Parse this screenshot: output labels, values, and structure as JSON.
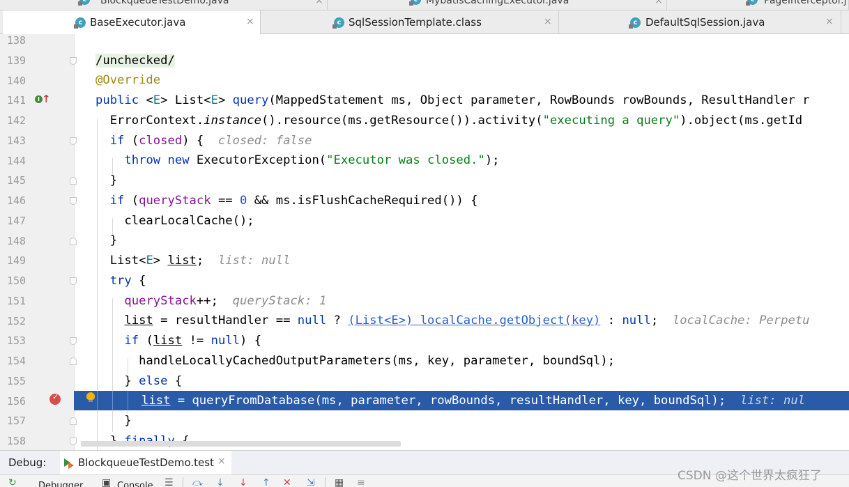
{
  "tabs_top": [
    {
      "label": "BlockqueueTestDemo.java"
    },
    {
      "label": "MybatisCachingExecutor.java"
    },
    {
      "label": "PageInterceptor.j"
    }
  ],
  "tabs": [
    {
      "label": "BaseExecutor.java",
      "active": true
    },
    {
      "label": "SqlSessionTemplate.class",
      "active": false
    },
    {
      "label": "DefaultSqlSession.java",
      "active": false
    }
  ],
  "file_icon_letter": "c",
  "close_glyph": "×",
  "line_numbers": [
    "138",
    "139",
    "140",
    "141",
    "142",
    "143",
    "144",
    "145",
    "146",
    "147",
    "148",
    "149",
    "150",
    "151",
    "152",
    "153",
    "154",
    "155",
    "156",
    "157",
    "158"
  ],
  "code": [
    {
      "id": "c139",
      "parts": [
        {
          "t": "/unchecked/",
          "c": "ucbg"
        }
      ]
    },
    {
      "id": "c140",
      "parts": [
        {
          "t": "@Override",
          "c": "ann"
        }
      ]
    },
    {
      "id": "c141",
      "parts": [
        {
          "t": "public ",
          "c": "kw"
        },
        {
          "t": "<"
        },
        {
          "t": "E",
          "c": "tp"
        },
        {
          "t": "> List<"
        },
        {
          "t": "E",
          "c": "tp"
        },
        {
          "t": "> "
        },
        {
          "t": "query",
          "c": "kw"
        },
        {
          "t": "(MappedStatement ms, Object parameter, RowBounds rowBounds, ResultHandler r"
        }
      ]
    },
    {
      "id": "c142",
      "parts": [
        {
          "t": "  ErrorContext."
        },
        {
          "t": "instance",
          "c": "ital"
        },
        {
          "t": "().resource(ms.getResource()).activity("
        },
        {
          "t": "\"executing a query\"",
          "c": "str"
        },
        {
          "t": ").object(ms.getId"
        }
      ]
    },
    {
      "id": "c143",
      "parts": [
        {
          "t": "  "
        },
        {
          "t": "if",
          "c": "kw"
        },
        {
          "t": " ("
        },
        {
          "t": "closed",
          "c": "fld"
        },
        {
          "t": ") {  "
        },
        {
          "t": "closed: false",
          "c": "hint"
        }
      ]
    },
    {
      "id": "c144",
      "parts": [
        {
          "t": "    "
        },
        {
          "t": "throw new",
          "c": "kw"
        },
        {
          "t": " ExecutorException("
        },
        {
          "t": "\"Executor was closed.\"",
          "c": "str"
        },
        {
          "t": ");"
        }
      ]
    },
    {
      "id": "c145",
      "parts": [
        {
          "t": "  }"
        }
      ]
    },
    {
      "id": "c146",
      "parts": [
        {
          "t": "  "
        },
        {
          "t": "if",
          "c": "kw"
        },
        {
          "t": " ("
        },
        {
          "t": "queryStack",
          "c": "fld"
        },
        {
          "t": " == "
        },
        {
          "t": "0",
          "c": "num"
        },
        {
          "t": " && ms.isFlushCacheRequired()) {"
        }
      ]
    },
    {
      "id": "c147",
      "parts": [
        {
          "t": "    clearLocalCache();"
        }
      ]
    },
    {
      "id": "c148",
      "parts": [
        {
          "t": "  }"
        }
      ]
    },
    {
      "id": "c149",
      "parts": [
        {
          "t": "  List<"
        },
        {
          "t": "E",
          "c": "tp"
        },
        {
          "t": "> "
        },
        {
          "t": "list",
          "c": "ul"
        },
        {
          "t": ";  "
        },
        {
          "t": "list: null",
          "c": "hint"
        }
      ]
    },
    {
      "id": "c150",
      "parts": [
        {
          "t": "  "
        },
        {
          "t": "try",
          "c": "kw"
        },
        {
          "t": " {"
        }
      ]
    },
    {
      "id": "c151",
      "parts": [
        {
          "t": "    "
        },
        {
          "t": "queryStack",
          "c": "fld"
        },
        {
          "t": "++;  "
        },
        {
          "t": "queryStack: 1",
          "c": "hint"
        }
      ]
    },
    {
      "id": "c152",
      "parts": [
        {
          "t": "    "
        },
        {
          "t": "list",
          "c": "ul"
        },
        {
          "t": " = resultHandler == "
        },
        {
          "t": "null",
          "c": "kw"
        },
        {
          "t": " ? "
        },
        {
          "t": "(List<E>) localCache.getObject(key)",
          "c": "lnk"
        },
        {
          "t": " : "
        },
        {
          "t": "null",
          "c": "kw"
        },
        {
          "t": ";  "
        },
        {
          "t": "localCache: Perpetu",
          "c": "hint"
        }
      ]
    },
    {
      "id": "c153",
      "parts": [
        {
          "t": "    "
        },
        {
          "t": "if",
          "c": "kw"
        },
        {
          "t": " ("
        },
        {
          "t": "list",
          "c": "ul"
        },
        {
          "t": " != "
        },
        {
          "t": "null",
          "c": "kw"
        },
        {
          "t": ") {"
        }
      ]
    },
    {
      "id": "c154",
      "parts": [
        {
          "t": "      handleLocallyCachedOutputParameters(ms, key, parameter, boundSql);"
        }
      ]
    },
    {
      "id": "c155",
      "parts": [
        {
          "t": "    } "
        },
        {
          "t": "else",
          "c": "kw"
        },
        {
          "t": " {"
        }
      ]
    },
    {
      "id": "c157",
      "parts": [
        {
          "t": "    }"
        }
      ]
    },
    {
      "id": "c158",
      "parts": [
        {
          "t": "  } "
        },
        {
          "t": "finally",
          "c": "kw"
        },
        {
          "t": " {"
        }
      ]
    }
  ],
  "exec_line": [
    {
      "t": "list",
      "c": "ul"
    },
    {
      "t": " = queryFromDatabase(ms, parameter, rowBounds, resultHandler, key, boundSql);  "
    },
    {
      "t": "list: nul",
      "c": "hintw"
    }
  ],
  "debug": {
    "label": "Debug:",
    "session": "BlockqueueTestDemo.test",
    "toolbar_labels": [
      "Debugger",
      "Console"
    ]
  },
  "icons": [
    "implements-icon",
    "override-up-icon",
    "breakpoint-icon",
    "intention-bulb-icon",
    "run-config-icon"
  ],
  "watermark": "CSDN @这个世界太疯狂了"
}
